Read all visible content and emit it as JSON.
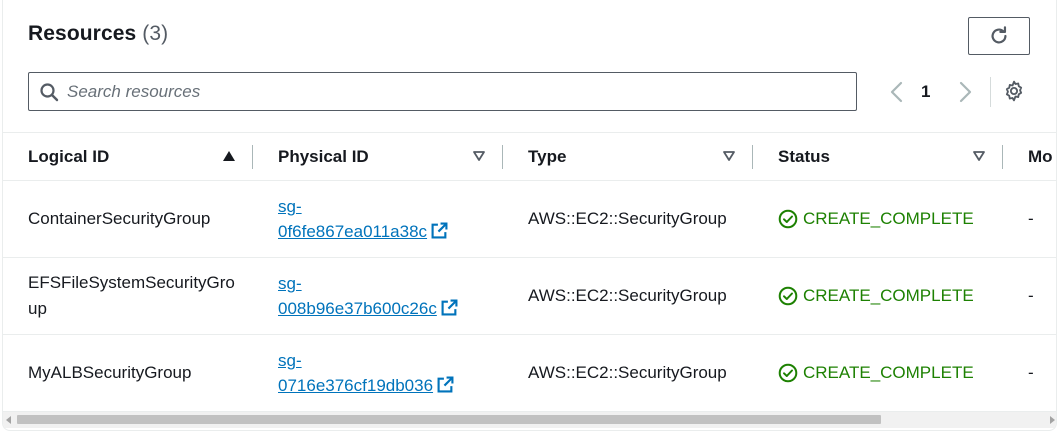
{
  "header": {
    "title": "Resources",
    "count": "(3)"
  },
  "toolbar": {
    "refresh_icon": "refresh-icon",
    "search_placeholder": "Search resources",
    "search_value": "",
    "page_number": "1",
    "settings_icon": "gear-icon"
  },
  "table": {
    "columns": [
      {
        "label": "Logical ID",
        "sort": "ascending"
      },
      {
        "label": "Physical ID",
        "sort": "none"
      },
      {
        "label": "Type",
        "sort": "none"
      },
      {
        "label": "Status",
        "sort": "none"
      },
      {
        "label": "Mo",
        "sort": "none"
      }
    ],
    "rows": [
      {
        "logical_id": "ContainerSecurityGroup",
        "physical_id_line1": "sg-",
        "physical_id_line2": "0f6fe867ea011a38c",
        "type": "AWS::EC2::SecurityGroup",
        "status": "CREATE_COMPLETE",
        "module": "-"
      },
      {
        "logical_id": "EFSFileSystemSecurityGroup",
        "physical_id_line1": "sg-",
        "physical_id_line2": "008b96e37b600c26c",
        "type": "AWS::EC2::SecurityGroup",
        "status": "CREATE_COMPLETE",
        "module": "-"
      },
      {
        "logical_id": "MyALBSecurityGroup",
        "physical_id_line1": "sg-",
        "physical_id_line2": "0716e376cf19db036",
        "type": "AWS::EC2::SecurityGroup",
        "status": "CREATE_COMPLETE",
        "module": "-"
      }
    ]
  },
  "colors": {
    "link": "#0073bb",
    "success": "#1d8102",
    "text": "#16191f",
    "muted": "#545b64"
  }
}
